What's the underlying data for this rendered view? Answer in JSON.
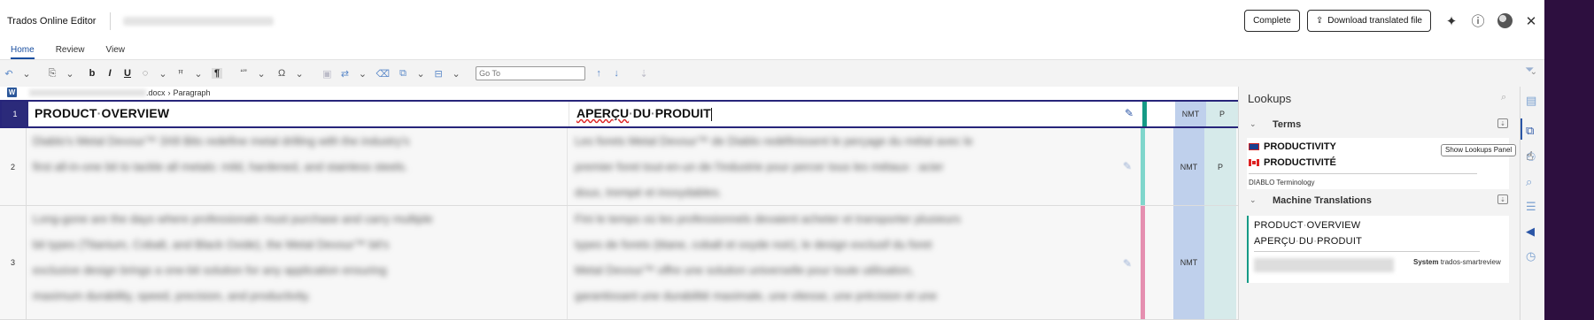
{
  "app": {
    "title": "Trados Online Editor",
    "complete_label": "Complete",
    "download_label": "Download translated file",
    "download_icon": "upload-icon",
    "plugin_icon": "puzzle-icon",
    "info_icon": "info-icon",
    "close_icon": "close-icon"
  },
  "tabs": [
    {
      "label": "Home",
      "active": true
    },
    {
      "label": "Review",
      "active": false
    },
    {
      "label": "View",
      "active": false
    }
  ],
  "toolbar": {
    "undo": "↶",
    "bold": "b",
    "italic": "I",
    "underline": "U",
    "formatting_marks": "¶",
    "quote": "“”",
    "omega": "Ω",
    "goto_placeholder": "Go To",
    "prev": "↑",
    "next": "↓",
    "confirm": "⇣",
    "overflow": "⌄"
  },
  "breadcrumb": {
    "file_suffix": ".docx",
    "separator": "›",
    "current": "Paragraph"
  },
  "segments": [
    {
      "number": "1",
      "source_tokens": [
        "PRODUCT",
        "OVERVIEW"
      ],
      "target_tokens": [
        "APERÇU",
        "DU",
        "PRODUIT"
      ],
      "mt": "NMT",
      "status": "P"
    },
    {
      "number": "2",
      "source_lines": [
        "Diablo's Metal Devour™ 3X8 Bits redefine metal drilling with the industry's",
        "first all-in-one bit to tackle all metals: mild, hardened, and stainless steels."
      ],
      "target_lines": [
        "Les forets Metal Devour™ de Diablo redéfinissent le perçage du métal avec le",
        "premier foret tout-en-un de l'industrie pour percer tous les métaux : acier",
        "doux, trempé et inoxydables."
      ],
      "mt": "NMT",
      "status": "P"
    },
    {
      "number": "3",
      "source_lines": [
        "Long-gone are the days where professionals must purchase and carry multiple",
        "bit types (Titanium, Cobalt, and Black Oxide), the Metal Devour™ bit's",
        "exclusive design brings a one-bit solution for any application ensuring",
        "maximum durability, speed, precision, and productivity."
      ],
      "target_lines": [
        "Fini le temps où les professionnels devaient acheter et transporter plusieurs",
        "types de forets (titane, cobalt et oxyde noir), le design exclusif du foret",
        "Metal Devour™ offre une solution universelle pour toute utilisation,",
        "garantissant une durabilité maximale, une vitesse, une précision et une"
      ],
      "mt": "NMT",
      "status": ""
    }
  ],
  "lookups": {
    "title": "Lookups",
    "terms_label": "Terms",
    "term_source": "PRODUCTIVITY",
    "term_target": "PRODUCTIVITÉ",
    "termbase": "DIABLO Terminology",
    "mt_label": "Machine Translations",
    "mt_source_tokens": [
      "PRODUCT",
      "OVERVIEW"
    ],
    "mt_target_tokens": [
      "APERÇU",
      "DU",
      "PRODUIT"
    ],
    "mt_system_label": "System",
    "mt_system_name": "trados-smartreview"
  },
  "tooltip": "Show Lookups Panel",
  "colors": {
    "active_segment": "#2b2a7a",
    "accent_blue": "#1a4fa0",
    "mt_col": "#bfd0ec",
    "status_col": "#d6eaea",
    "seg1_bar": "#159a86",
    "seg2_bar": "#7fd6cc",
    "seg3_bar": "#e58fb0",
    "brand_strip": "#2d0f3f"
  }
}
